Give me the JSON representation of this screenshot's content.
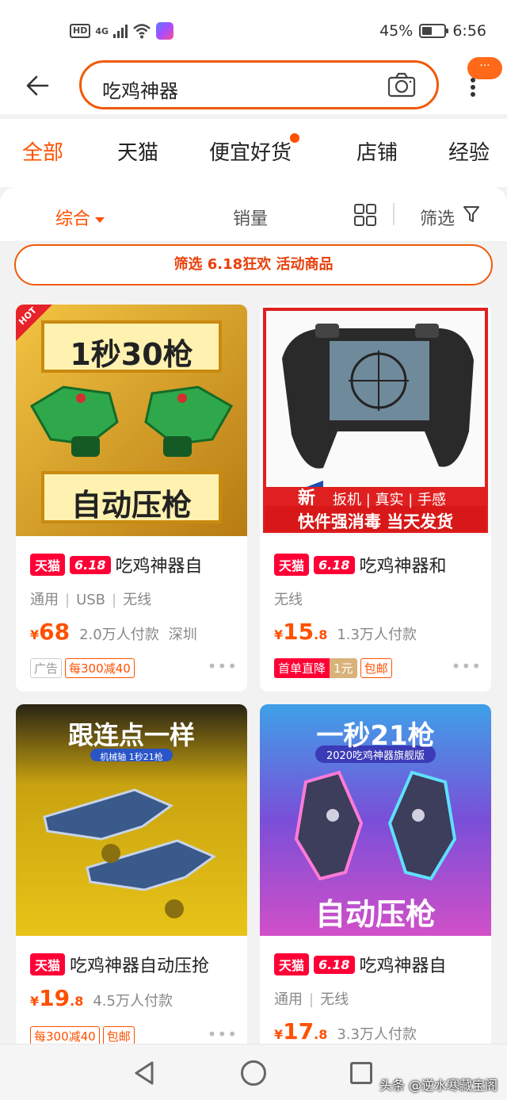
{
  "status_bar": {
    "hd": "HD",
    "network": "4G",
    "battery": "45%",
    "battery_level": 0.45,
    "time": "6:56"
  },
  "search": {
    "query": "吃鸡神器",
    "more_bubble": "···"
  },
  "tabs": [
    {
      "label": "全部",
      "active": true
    },
    {
      "label": "天猫"
    },
    {
      "label": "便宜好货",
      "dot": true
    },
    {
      "label": "店铺"
    },
    {
      "label": "经验"
    }
  ],
  "sort": {
    "comprehensive": "综合",
    "sales": "销量",
    "filter": "筛选"
  },
  "promo_banner": "筛选 6.18狂欢 活动商品",
  "products": [
    {
      "image_badge": "HOT",
      "image_top": "1秒30枪",
      "image_bottom": "自动压枪",
      "tmall": "天猫",
      "event": "6.18",
      "title": "吃鸡神器自",
      "attrs": [
        "通用",
        "USB",
        "无线"
      ],
      "currency": "¥",
      "price_int": "68",
      "price_dec": "",
      "sales": "2.0万人付款",
      "location": "深圳",
      "tags": [
        "广告",
        "每300减40"
      ]
    },
    {
      "image_banner_new": "新",
      "image_banner1": "扳机 | 真实 | 手感",
      "image_banner2": "快件强消毒 当天发货",
      "tmall": "天猫",
      "event": "6.18",
      "title": "吃鸡神器和",
      "attrs": [
        "无线"
      ],
      "currency": "¥",
      "price_int": "15",
      "price_dec": ".8",
      "sales": "1.3万人付款",
      "tags": [
        "首单直降",
        "1元",
        "包邮"
      ]
    },
    {
      "image_top": "跟连点一样",
      "image_sub": "机械轴 1秒21枪",
      "tmall": "天猫",
      "title": "吃鸡神器自动压抢",
      "currency": "¥",
      "price_int": "19",
      "price_dec": ".8",
      "sales": "4.5万人付款",
      "tags": [
        "每300减40",
        "包邮"
      ]
    },
    {
      "image_top": "一秒21枪",
      "image_sub": "2020吃鸡神器旗舰版",
      "image_bottom": "自动压枪",
      "tmall": "天猫",
      "event": "6.18",
      "title": "吃鸡神器自",
      "attrs": [
        "通用",
        "无线"
      ],
      "currency": "¥",
      "price_int": "17",
      "price_dec": ".8",
      "sales": "3.3万人付款"
    }
  ],
  "watermark": "头条 @逆水寒藏宝阁"
}
